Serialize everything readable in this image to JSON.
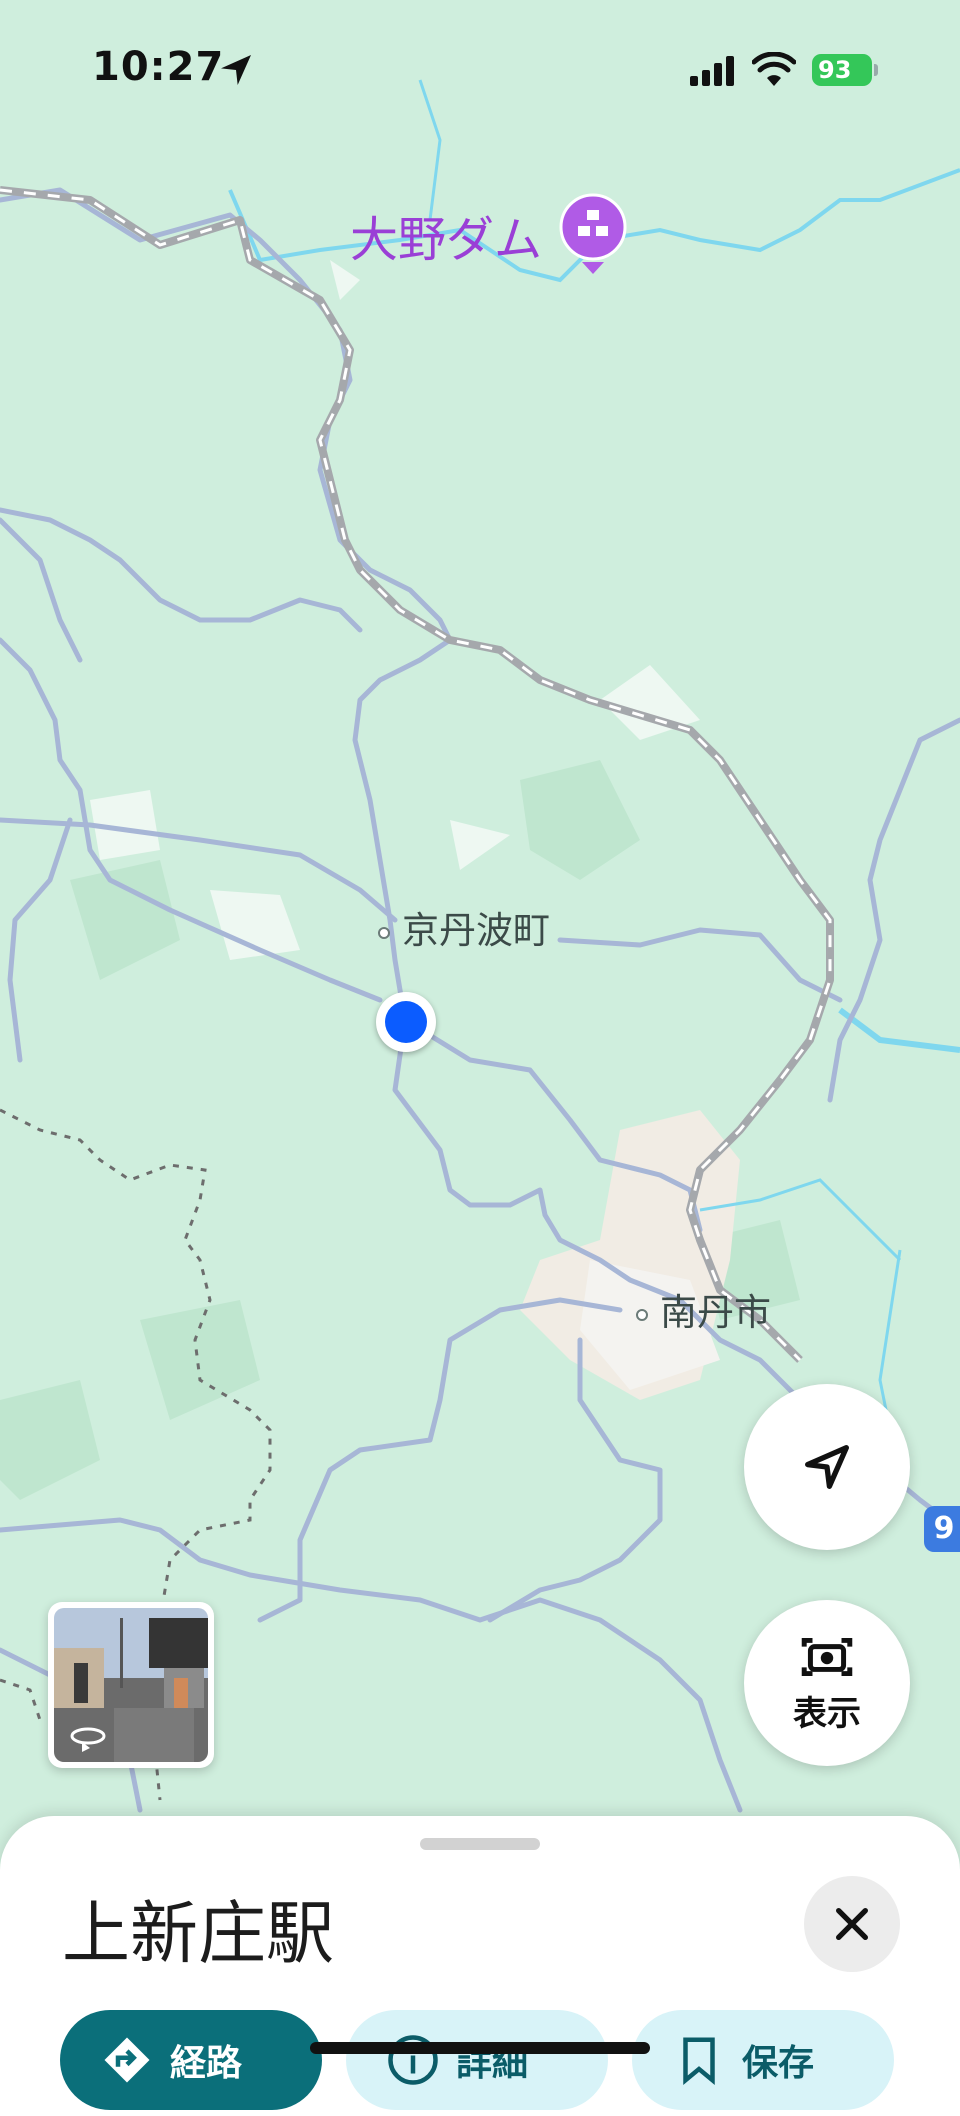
{
  "status_bar": {
    "time": "10:27",
    "battery": "93",
    "icons": [
      "location-arrow-icon",
      "cellular-signal-icon",
      "wifi-icon",
      "battery-charging-icon"
    ]
  },
  "map": {
    "poi": {
      "label": "大野ダム",
      "icon": "dam-poi-icon",
      "color": "#9a3fd6"
    },
    "places": [
      {
        "label": "京丹波町"
      },
      {
        "label": "南丹市"
      }
    ],
    "route_shield": "9",
    "colors": {
      "land": "#cfeedd",
      "forest": "#bfe6cf",
      "road": "#a7b6d6",
      "water": "#7fd7ee",
      "user_location": "#0b5cff"
    }
  },
  "controls": {
    "recenter_icon": "navigation-arrow-icon",
    "display_label": "表示",
    "display_icon": "camera-lens-icon",
    "streetview_icon": "rotate-360-icon"
  },
  "sheet": {
    "title": "上新庄駅",
    "close_icon": "close-icon",
    "actions": [
      {
        "label": "経路",
        "icon": "directions-icon"
      },
      {
        "label": "詳細",
        "icon": "info-icon"
      },
      {
        "label": "保存",
        "icon": "bookmark-icon"
      }
    ]
  }
}
